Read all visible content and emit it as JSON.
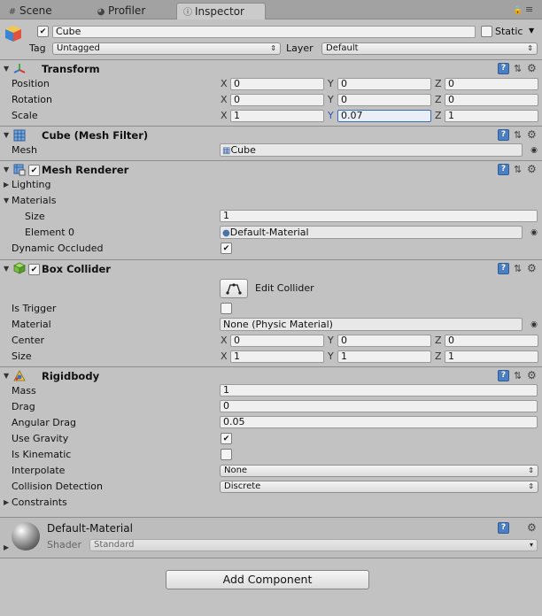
{
  "tabs": [
    {
      "label": "Scene",
      "icon": "scene-icon"
    },
    {
      "label": "Profiler",
      "icon": "profiler-icon"
    },
    {
      "label": "Inspector",
      "icon": "info-icon"
    }
  ],
  "header": {
    "name": "Cube",
    "active": true,
    "static_label": "Static",
    "static_checked": false,
    "tag_label": "Tag",
    "tag_value": "Untagged",
    "layer_label": "Layer",
    "layer_value": "Default"
  },
  "transform": {
    "title": "Transform",
    "position_label": "Position",
    "rotation_label": "Rotation",
    "scale_label": "Scale",
    "axes": [
      "X",
      "Y",
      "Z"
    ],
    "position": [
      "0",
      "0",
      "0"
    ],
    "rotation": [
      "0",
      "0",
      "0"
    ],
    "scale": [
      "1",
      "0.07",
      "1"
    ]
  },
  "mesh_filter": {
    "title": "Cube (Mesh Filter)",
    "mesh_label": "Mesh",
    "mesh_value": "Cube"
  },
  "mesh_renderer": {
    "title": "Mesh Renderer",
    "enabled": true,
    "lighting_label": "Lighting",
    "materials_label": "Materials",
    "size_label": "Size",
    "size_value": "1",
    "element0_label": "Element 0",
    "element0_value": "Default-Material",
    "dynamic_occluded_label": "Dynamic Occluded",
    "dynamic_occluded": true
  },
  "box_collider": {
    "title": "Box Collider",
    "enabled": true,
    "edit_collider_label": "Edit Collider",
    "is_trigger_label": "Is Trigger",
    "is_trigger": false,
    "material_label": "Material",
    "material_value": "None (Physic Material)",
    "center_label": "Center",
    "center": [
      "0",
      "0",
      "0"
    ],
    "size_label": "Size",
    "size": [
      "1",
      "1",
      "1"
    ]
  },
  "rigidbody": {
    "title": "Rigidbody",
    "mass_label": "Mass",
    "mass": "1",
    "drag_label": "Drag",
    "drag": "0",
    "angular_drag_label": "Angular Drag",
    "angular_drag": "0.05",
    "use_gravity_label": "Use Gravity",
    "use_gravity": true,
    "is_kinematic_label": "Is Kinematic",
    "is_kinematic": false,
    "interpolate_label": "Interpolate",
    "interpolate": "None",
    "collision_label": "Collision Detection",
    "collision": "Discrete",
    "constraints_label": "Constraints"
  },
  "material": {
    "name": "Default-Material",
    "shader_label": "Shader",
    "shader_value": "Standard"
  },
  "add_component_label": "Add Component",
  "colors": {
    "panel_bg": "#c2c2c2",
    "tab_bar": "#a2a2a2",
    "field_bg": "#f0f0f0",
    "help_blue": "#4c7fc1",
    "selected_border": "#3d6bbd"
  }
}
